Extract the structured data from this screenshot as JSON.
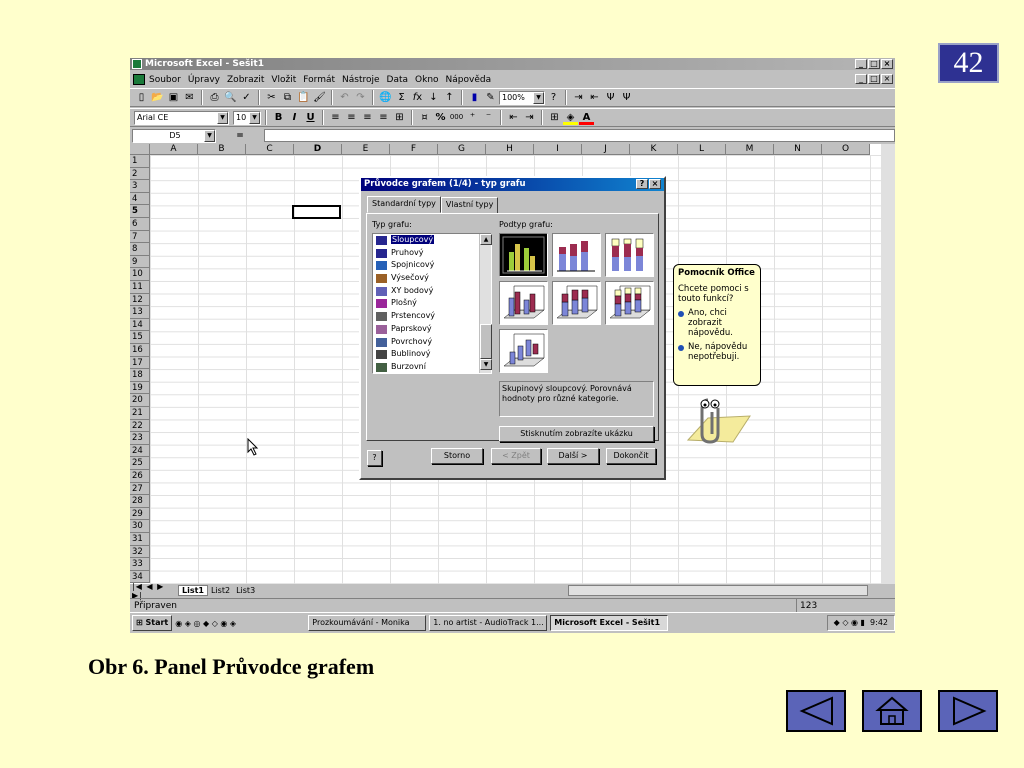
{
  "slide_number": "42",
  "caption": "Obr 6. Panel Průvodce grafem",
  "window": {
    "title": "Microsoft Excel - Sešit1"
  },
  "menu": [
    "Soubor",
    "Úpravy",
    "Zobrazit",
    "Vložit",
    "Formát",
    "Nástroje",
    "Data",
    "Okno",
    "Nápověda"
  ],
  "toolbar": {
    "zoom": "100%",
    "font_name": "Arial CE",
    "font_size": "10",
    "bold": "B",
    "italic": "I",
    "underline": "U",
    "percent": "%",
    "thousands": "000"
  },
  "formula_bar": {
    "cell_ref": "D5",
    "equals": "="
  },
  "columns": [
    "A",
    "B",
    "C",
    "D",
    "E",
    "F",
    "G",
    "H",
    "I",
    "J",
    "K",
    "L",
    "M",
    "N",
    "O"
  ],
  "rows": [
    "1",
    "2",
    "3",
    "4",
    "5",
    "6",
    "7",
    "8",
    "9",
    "10",
    "11",
    "12",
    "13",
    "14",
    "15",
    "16",
    "17",
    "18",
    "19",
    "20",
    "21",
    "22",
    "23",
    "24",
    "25",
    "26",
    "27",
    "28",
    "29",
    "30",
    "31",
    "32",
    "33",
    "34"
  ],
  "sheet_tabs": [
    "List1",
    "List2",
    "List3"
  ],
  "status": {
    "text": "Připraven",
    "num": "123"
  },
  "dialog": {
    "title": "Průvodce grafem (1/4) - typ grafu",
    "help": "?",
    "close": "×",
    "tabs": [
      "Standardní typy",
      "Vlastní typy"
    ],
    "type_label": "Typ grafu:",
    "subtype_label": "Podtyp grafu:",
    "chart_types": [
      "Sloupcový",
      "Pruhový",
      "Spojnicový",
      "Výsečový",
      "XY bodový",
      "Plošný",
      "Prstencový",
      "Paprskový",
      "Povrchový",
      "Bublinový",
      "Burzovní"
    ],
    "description": "Skupinový sloupcový. Porovnává hodnoty pro různé kategorie.",
    "preview_button": "Stisknutím zobrazíte ukázku",
    "buttons": {
      "cancel": "Storno",
      "back": "< Zpět",
      "next": "Další >",
      "finish": "Dokončit"
    }
  },
  "assistant": {
    "title": "Pomocník Office",
    "question": "Chcete pomoci s touto funkcí?",
    "yes": "Ano, chci zobrazit nápovědu.",
    "no": "Ne, nápovědu nepotřebuji."
  },
  "taskbar": {
    "start": "Start",
    "items": [
      "Prozkoumávání - Monika",
      "1. no artist - AudioTrack 1...",
      "Microsoft Excel - Sešit1"
    ],
    "clock": "9:42"
  },
  "colors": {
    "slide_bg": "#ffffcc",
    "badge": "#2e3192",
    "nav": "#5b64b8",
    "title_blue": "#00007b"
  }
}
